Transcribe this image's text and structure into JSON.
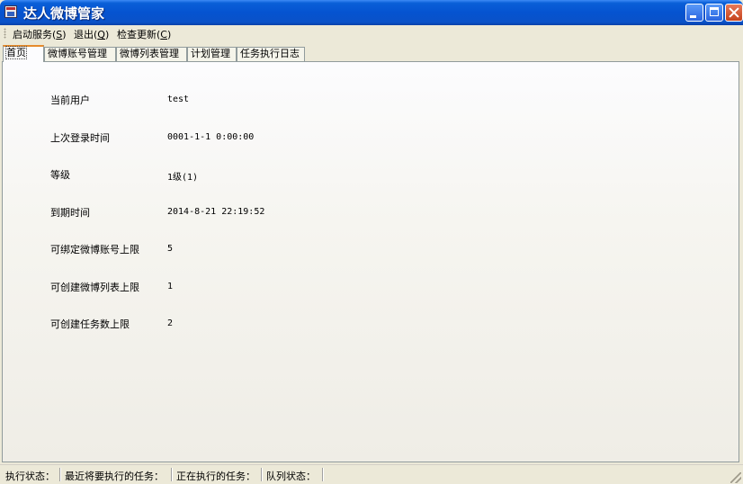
{
  "window": {
    "title": "达人微博管家"
  },
  "menu": {
    "items": [
      {
        "label": "启动服务(",
        "key": "S",
        "suffix": ")"
      },
      {
        "label": "退出(",
        "key": "Q",
        "suffix": ")"
      },
      {
        "label": "检查更新(",
        "key": "C",
        "suffix": ")"
      }
    ]
  },
  "tabs": [
    {
      "label": "首页",
      "active": true
    },
    {
      "label": "微博账号管理"
    },
    {
      "label": "微博列表管理"
    },
    {
      "label": "计划管理"
    },
    {
      "label": "任务执行日志"
    }
  ],
  "info": {
    "rows": [
      {
        "label": "当前用户",
        "value": "test"
      },
      {
        "label": "上次登录时间",
        "value": "0001-1-1 0:00:00"
      },
      {
        "label": "等级",
        "value": "1级(1)"
      },
      {
        "label": "到期时间",
        "value": "2014-8-21 22:19:52"
      },
      {
        "label": "可绑定微博账号上限",
        "value": "5"
      },
      {
        "label": "可创建微博列表上限",
        "value": "1"
      },
      {
        "label": "可创建任务数上限",
        "value": "2"
      }
    ]
  },
  "status": {
    "exec_state": "执行状态：",
    "next_task": "最近将要执行的任务：",
    "running_task": "正在执行的任务：",
    "queue_state": "队列状态："
  },
  "colors": {
    "titlebar": "#0553d0",
    "active_tab_accent": "#e68b2c",
    "close_button": "#c4421c"
  }
}
